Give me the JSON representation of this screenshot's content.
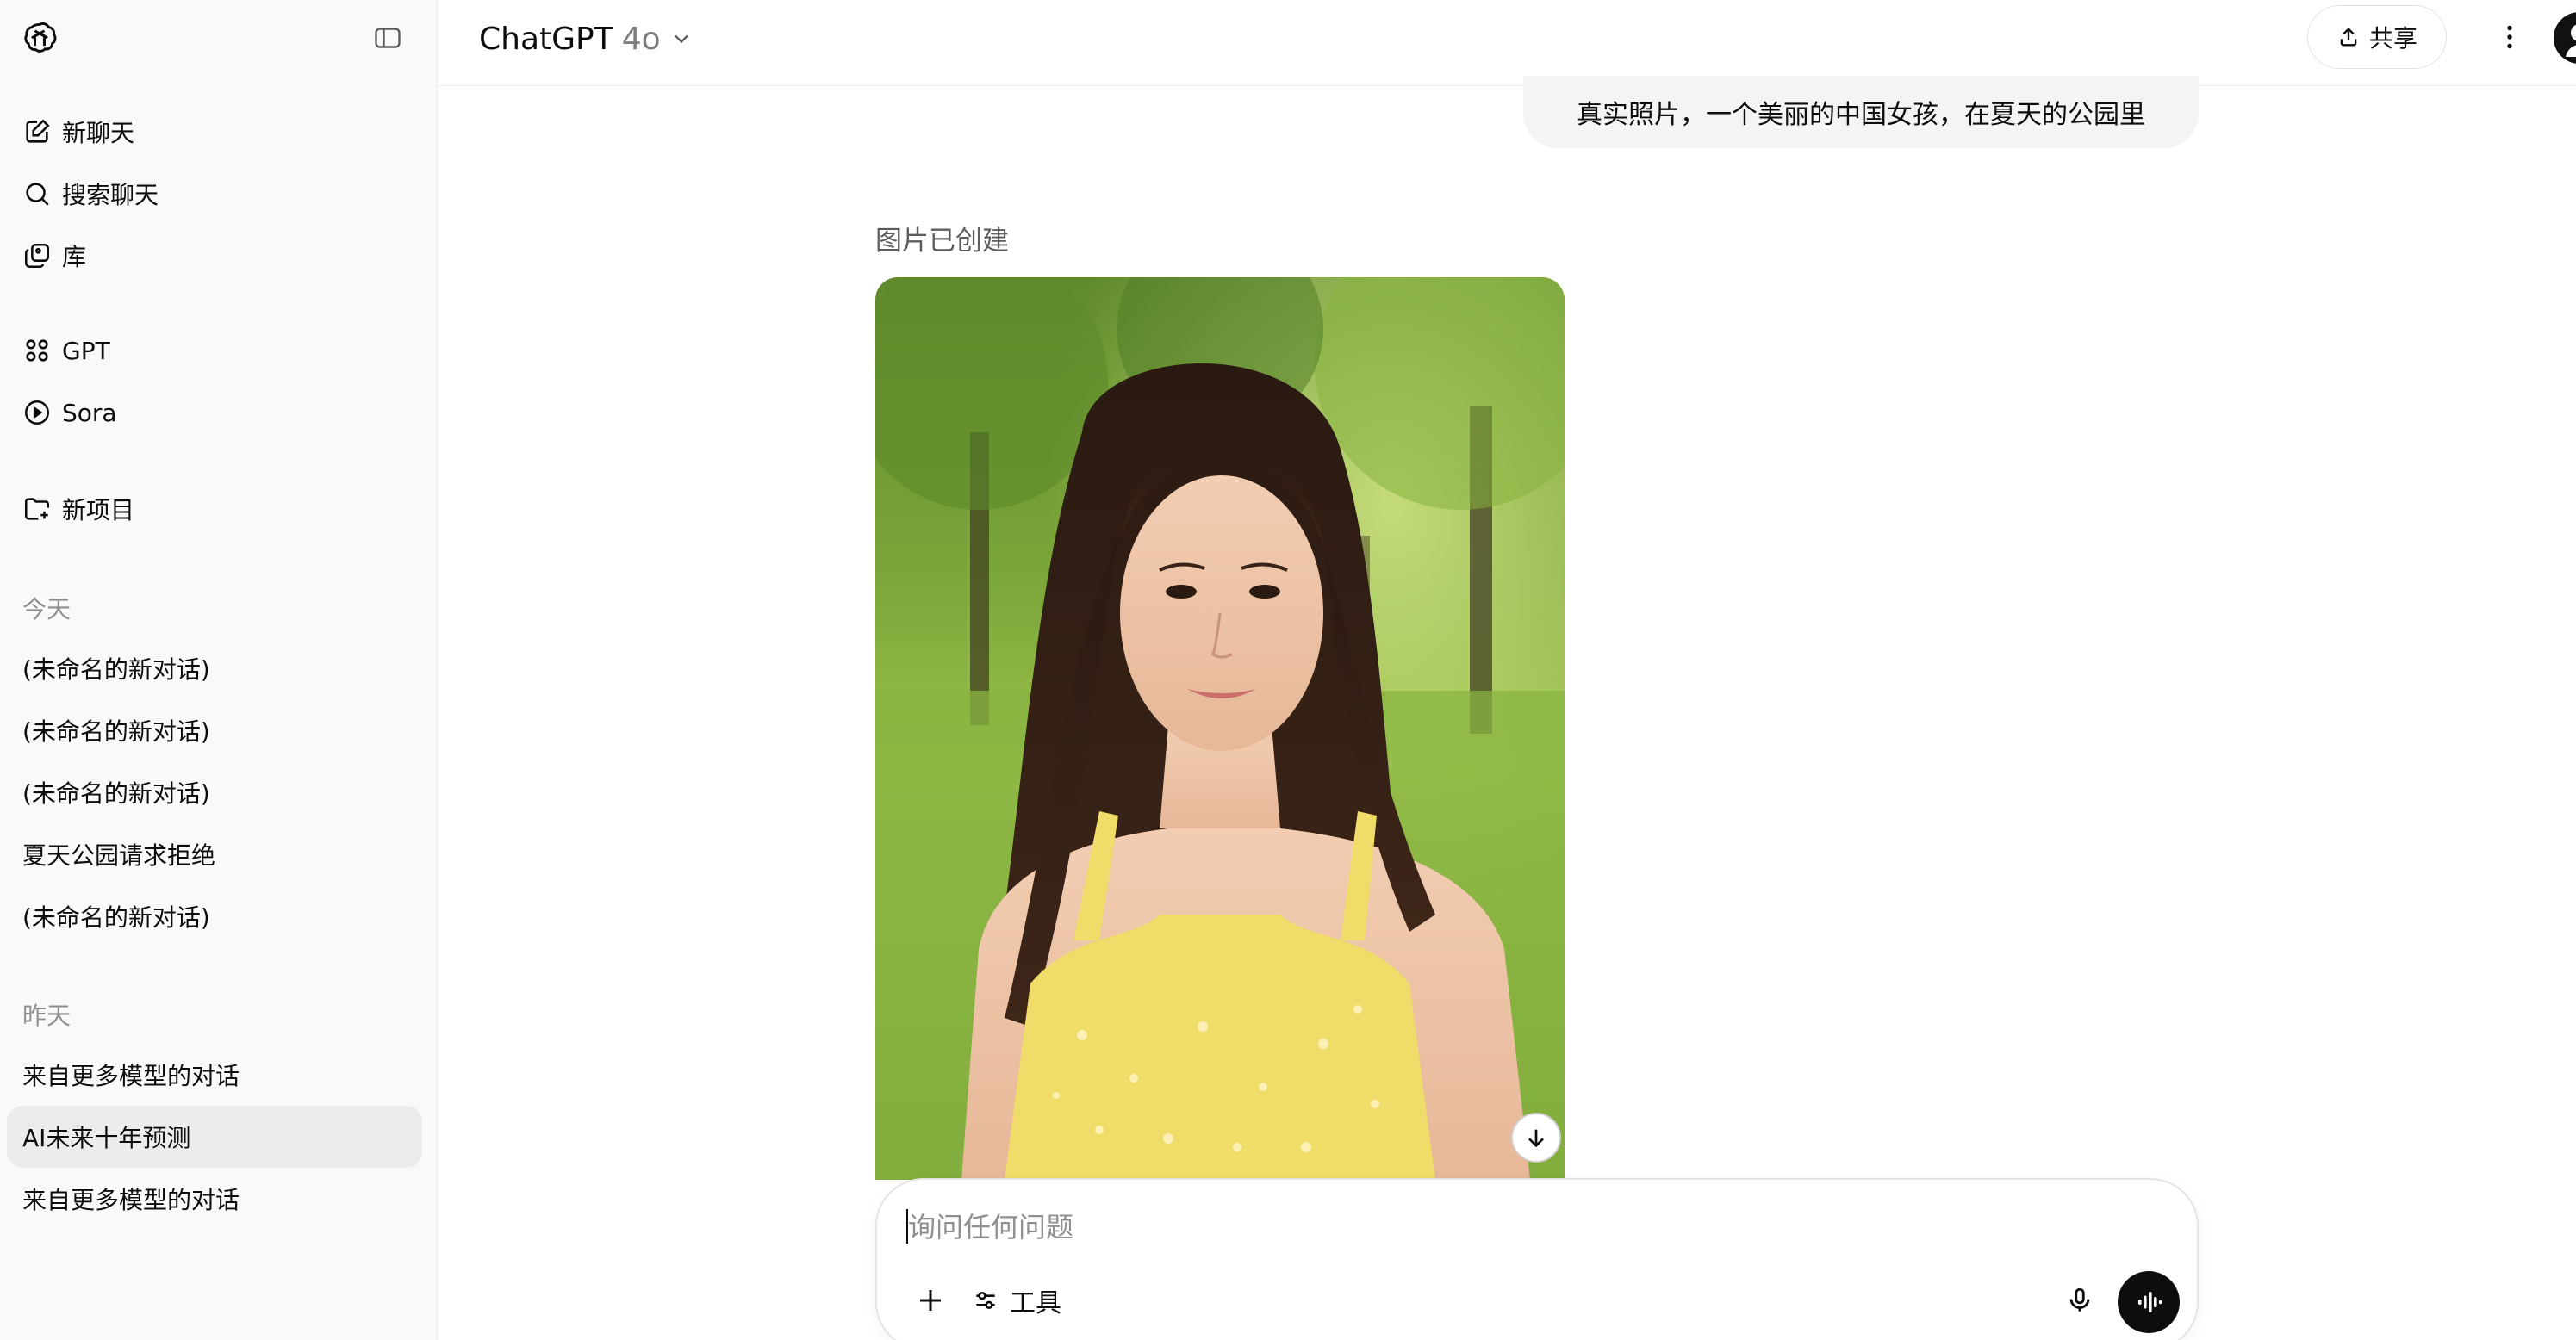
{
  "sidebar": {
    "nav": [
      {
        "label": "新聊天",
        "icon": "edit-icon"
      },
      {
        "label": "搜索聊天",
        "icon": "search-icon"
      },
      {
        "label": "库",
        "icon": "library-icon"
      },
      {
        "label": "GPT",
        "icon": "grid-icon"
      },
      {
        "label": "Sora",
        "icon": "play-circle-icon"
      },
      {
        "label": "新项目",
        "icon": "folder-plus-icon"
      }
    ],
    "sections": [
      {
        "label": "今天",
        "items": [
          "(未命名的新对话)",
          "(未命名的新对话)",
          "(未命名的新对话)",
          "夏天公园请求拒绝",
          "(未命名的新对话)"
        ]
      },
      {
        "label": "昨天",
        "items": [
          "来自更多模型的对话",
          "AI未来十年预测",
          "来自更多模型的对话"
        ]
      }
    ],
    "active_item": "AI未来十年预测"
  },
  "header": {
    "model_name": "ChatGPT",
    "model_version": "4o",
    "share_label": "共享"
  },
  "conversation": {
    "user_message": "真实照片，一个美丽的中国女孩，在夏天的公园里",
    "image_status": "图片已创建"
  },
  "composer": {
    "placeholder": "询问任何问题",
    "tools_label": "工具"
  },
  "colors": {
    "sidebar_bg": "#f9f9f9",
    "active_item_bg": "#ececec",
    "bubble_bg": "#f4f4f4",
    "voice_btn_bg": "#0d0d0d"
  }
}
